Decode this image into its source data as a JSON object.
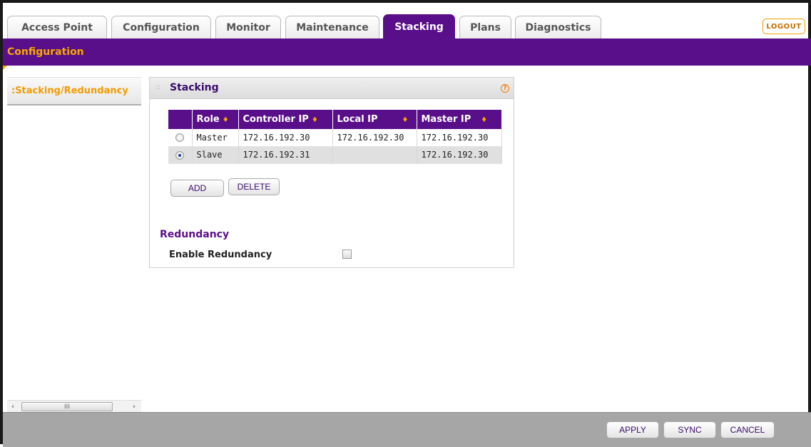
{
  "tabs": [
    {
      "label": "Access Point",
      "active": false
    },
    {
      "label": "Configuration",
      "active": false
    },
    {
      "label": "Monitor",
      "active": false
    },
    {
      "label": "Maintenance",
      "active": false
    },
    {
      "label": "Stacking",
      "active": true
    },
    {
      "label": "Plans",
      "active": false
    },
    {
      "label": "Diagnostics",
      "active": false
    }
  ],
  "logout_label": "LOGOUT",
  "subnav_label": "Configuration",
  "sidebar": {
    "items": [
      {
        "label": ":Stacking/Redundancy"
      }
    ]
  },
  "panel": {
    "title": "Stacking",
    "help_glyph": "?",
    "table": {
      "columns": [
        "",
        "Role",
        "Controller IP",
        "Local IP",
        "Master IP"
      ],
      "sort_glyph": "♦",
      "rows": [
        {
          "selected": false,
          "role": "Master",
          "controller_ip": "172.16.192.30",
          "local_ip": "172.16.192.30",
          "master_ip": "172.16.192.30"
        },
        {
          "selected": true,
          "role": "Slave",
          "controller_ip": "172.16.192.31",
          "local_ip": "",
          "master_ip": "172.16.192.30"
        }
      ]
    },
    "add_label": "ADD",
    "delete_label": "DELETE",
    "redundancy_heading": "Redundancy",
    "enable_redundancy_label": "Enable Redundancy",
    "enable_redundancy_checked": false
  },
  "scrollbar": {
    "left_arrow": "‹",
    "thumb_grip": "III",
    "right_arrow": "›"
  },
  "footer": {
    "apply_label": "APPLY",
    "sync_label": "SYNC",
    "cancel_label": "CANCEL"
  },
  "colors": {
    "brand_purple": "#5a0f8a",
    "accent_orange": "#f7a800"
  }
}
